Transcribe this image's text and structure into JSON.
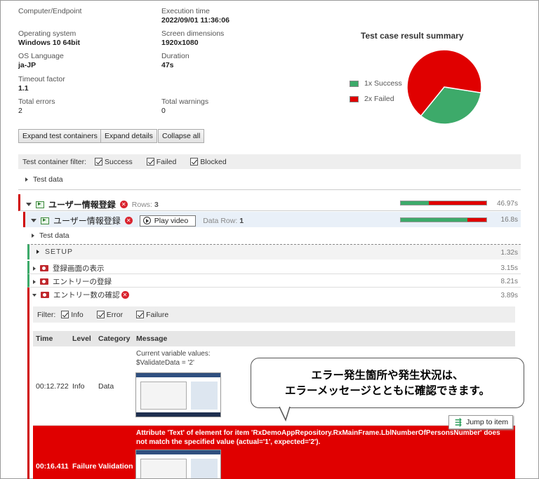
{
  "info": {
    "computer_label": "Computer/Endpoint",
    "exec_label": "Execution time",
    "exec_value": "2022/09/01 11:36:06",
    "os_label": "Operating system",
    "os_value": "Windows 10 64bit",
    "screen_label": "Screen dimensions",
    "screen_value": "1920x1080",
    "lang_label": "OS Language",
    "lang_value": "ja-JP",
    "duration_label": "Duration",
    "duration_value": "47s",
    "timeout_label": "Timeout factor",
    "timeout_value": "1.1",
    "errors_label": "Total errors",
    "errors_value": "2",
    "warnings_label": "Total warnings",
    "warnings_value": "0"
  },
  "chart_data": {
    "type": "pie",
    "title": "Test case result summary",
    "series": [
      {
        "name": "1x Success",
        "value": 1,
        "color": "#3daa6a"
      },
      {
        "name": "2x Failed",
        "value": 2,
        "color": "#e00000"
      }
    ]
  },
  "buttons": {
    "expand_containers": "Expand test containers",
    "expand_details": "Expand details",
    "collapse_all": "Collapse all"
  },
  "filter": {
    "label": "Test container filter:",
    "success": "Success",
    "failed": "Failed",
    "blocked": "Blocked"
  },
  "test_data_1": "Test data",
  "container": {
    "name": "ユーザー情報登録",
    "rows_label": "Rows:",
    "rows_value": "3",
    "duration": "46.97s"
  },
  "testcase": {
    "name": "ユーザー情報登録",
    "play": "Play video",
    "row_label": "Data Row:",
    "row_value": "1",
    "duration": "16.8s"
  },
  "test_data_2": "Test data",
  "setup": {
    "label": "SETUP",
    "duration": "1.32s"
  },
  "modules": [
    {
      "name": "登録画面の表示",
      "duration": "3.15s"
    },
    {
      "name": "エントリーの登録",
      "duration": "8.21s"
    },
    {
      "name": "エントリー数の確認",
      "duration": "3.89s"
    }
  ],
  "log_filter": {
    "label": "Filter:",
    "info": "Info",
    "error": "Error",
    "failure": "Failure"
  },
  "table": {
    "headers": [
      "Time",
      "Level",
      "Category",
      "Message"
    ],
    "rows": [
      {
        "time": "00:12.722",
        "level": "Info",
        "category": "Data",
        "message": "Current variable values:\n$ValidateData = '2'"
      },
      {
        "time": "00:16.411",
        "level": "Failure",
        "category": "Validation",
        "message": "Attribute 'Text' of element for item 'RxDemoAppRepository.RxMainFrame.LblNumberOfPersonsNumber' does not match the specified value (actual='1', expected='2')."
      }
    ]
  },
  "jump": "Jump to item",
  "callout": {
    "line1": "エラー発生箇所や発生状況は、",
    "line2": "エラーメッセージとともに確認できます。"
  },
  "colors": {
    "success": "#3daa6a",
    "failed": "#e00000",
    "failure_row": "#e00000"
  }
}
